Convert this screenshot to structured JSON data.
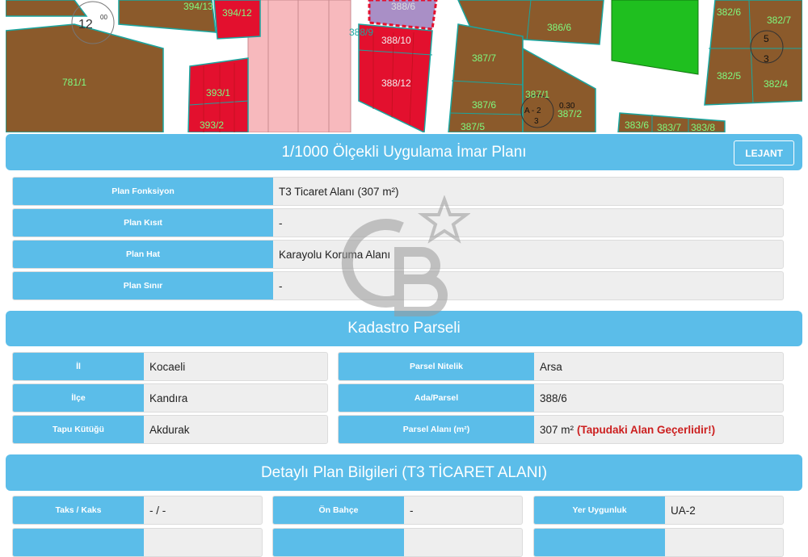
{
  "map": {
    "labels": {
      "p394_13": "394/13",
      "p394_12": "394/12",
      "p388_6": "388/6",
      "p386_6": "386/6",
      "p382_6": "382/6",
      "p382_7": "382/7",
      "p781_1": "781/1",
      "p388_9": "388/9",
      "p388_10": "388/10",
      "p388_12": "388/12",
      "p387_7": "387/7",
      "p393_1": "393/1",
      "p393_2": "393/2",
      "p387_6": "387/6",
      "p387_1": "387/1",
      "p387_2": "387/2",
      "p387_5": "387/5",
      "p382_5": "382/5",
      "p382_4": "382/4",
      "p383_6": "383/6",
      "p383_7": "383/7",
      "p383_8": "383/8"
    },
    "zone_marks": {
      "left": {
        "top": "12",
        "sup": "00"
      },
      "center": {
        "top": "A - 2",
        "num": "3",
        "ratio": "0.30"
      },
      "right": {
        "top": "5",
        "num": "3"
      }
    }
  },
  "plan": {
    "title": "1/1000 Ölçekli Uygulama İmar Planı",
    "legend_button": "LEJANT",
    "rows": [
      {
        "label": "Plan Fonksiyon",
        "value": "T3 Ticaret Alanı (307 m²)"
      },
      {
        "label": "Plan Kısıt",
        "value": "-"
      },
      {
        "label": "Plan Hat",
        "value": "Karayolu Koruma Alanı"
      },
      {
        "label": "Plan Sınır",
        "value": "-"
      }
    ]
  },
  "cadastre": {
    "title": "Kadastro Parseli",
    "left_rows": [
      {
        "label": "İl",
        "value": "Kocaeli"
      },
      {
        "label": "İlçe",
        "value": "Kandıra"
      },
      {
        "label": "Tapu Kütüğü",
        "value": "Akdurak"
      }
    ],
    "right_rows": [
      {
        "label": "Parsel Nitelik",
        "value": "Arsa"
      },
      {
        "label": "Ada/Parsel",
        "value": "388/6"
      },
      {
        "label": "Parsel Alanı (m²)",
        "value": "307 m²",
        "warning": "(Tapudaki Alan Geçerlidir!)"
      }
    ]
  },
  "detail": {
    "title": "Detaylı Plan Bilgileri (T3 TİCARET ALANI)",
    "rows": [
      {
        "label": "Taks / Kaks",
        "value": "- / -"
      },
      {
        "label": "Ön Bahçe",
        "value": "-"
      },
      {
        "label": "Yer Uygunluk",
        "value": "UA-2"
      }
    ]
  },
  "colors": {
    "accent": "#5bbde9",
    "parcel_brown": "#8b5a2b",
    "parcel_red": "#e3102e",
    "parcel_green": "#1fbf1f",
    "road_pink": "#f7b9bd",
    "selected_purple": "#a98fc6",
    "warning_red": "#cc1f1f"
  }
}
